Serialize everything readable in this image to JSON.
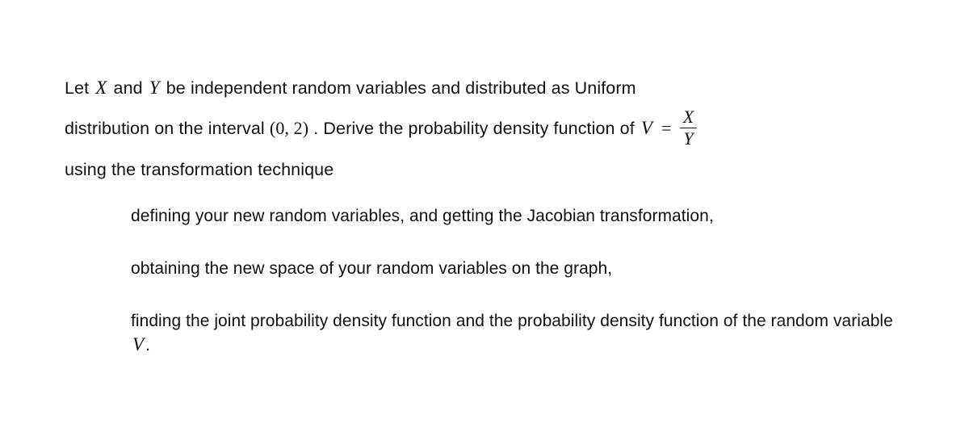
{
  "document": {
    "background_color": "#ffffff",
    "text_color": "#111111"
  },
  "problem": {
    "line1_part1": "Let",
    "line1_var_x": "X",
    "line1_part2": "and",
    "line1_var_y": "Y",
    "line1_part3": "be independent random variables and distributed as Uniform",
    "line2_part1": "distribution on the interval",
    "line2_interval": "(0, 2)",
    "line2_part2": ". Derive the probability density function of",
    "line2_var_v": "V",
    "line2_equals": "=",
    "line2_frac_numerator": "X",
    "line2_frac_denominator": "Y",
    "line3": "using the transformation technique"
  },
  "sub_items": [
    {
      "text": "defining your new random variables, and getting the Jacobian transformation,"
    },
    {
      "text": "obtaining the new space of your random variables on the graph,"
    },
    {
      "text_before_var": "finding the joint probability density function and the probability density function of the random variable",
      "var": "V",
      "text_after_var": "."
    }
  ]
}
